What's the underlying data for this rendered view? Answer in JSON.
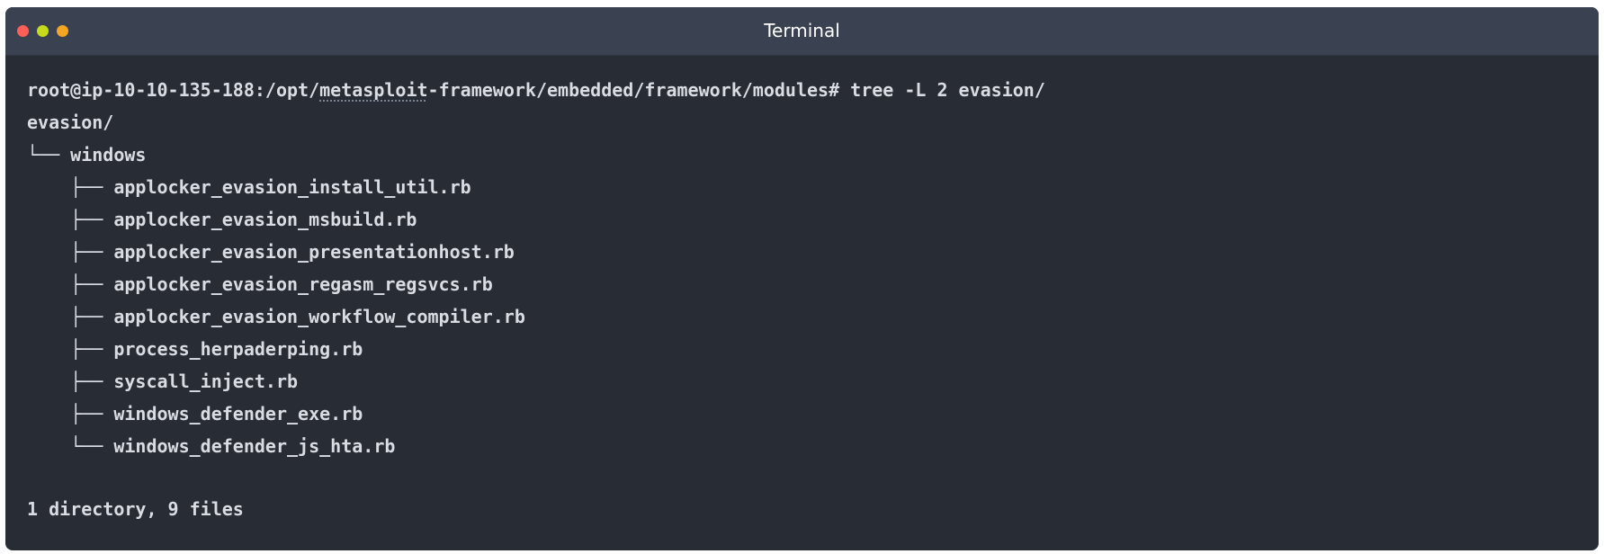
{
  "window": {
    "title": "Terminal"
  },
  "terminal": {
    "prompt_user_host": "root@ip-10-10-135-188",
    "prompt_path_pre": ":/opt/",
    "prompt_path_underlined": "metasploit",
    "prompt_path_post": "-framework/embedded/framework/modules#",
    "command": " tree -L 2 evasion/",
    "tree": [
      "evasion/",
      "└── windows",
      "    ├── applocker_evasion_install_util.rb",
      "    ├── applocker_evasion_msbuild.rb",
      "    ├── applocker_evasion_presentationhost.rb",
      "    ├── applocker_evasion_regasm_regsvcs.rb",
      "    ├── applocker_evasion_workflow_compiler.rb",
      "    ├── process_herpaderping.rb",
      "    ├── syscall_inject.rb",
      "    ├── windows_defender_exe.rb",
      "    └── windows_defender_js_hta.rb"
    ],
    "summary": "1 directory, 9 files"
  },
  "colors": {
    "background": "#282c34",
    "titlebar": "#3a4150",
    "text": "#d9dde3",
    "close": "#ff5f57",
    "minimize": "#c6db1a",
    "maximize": "#f5a524"
  }
}
